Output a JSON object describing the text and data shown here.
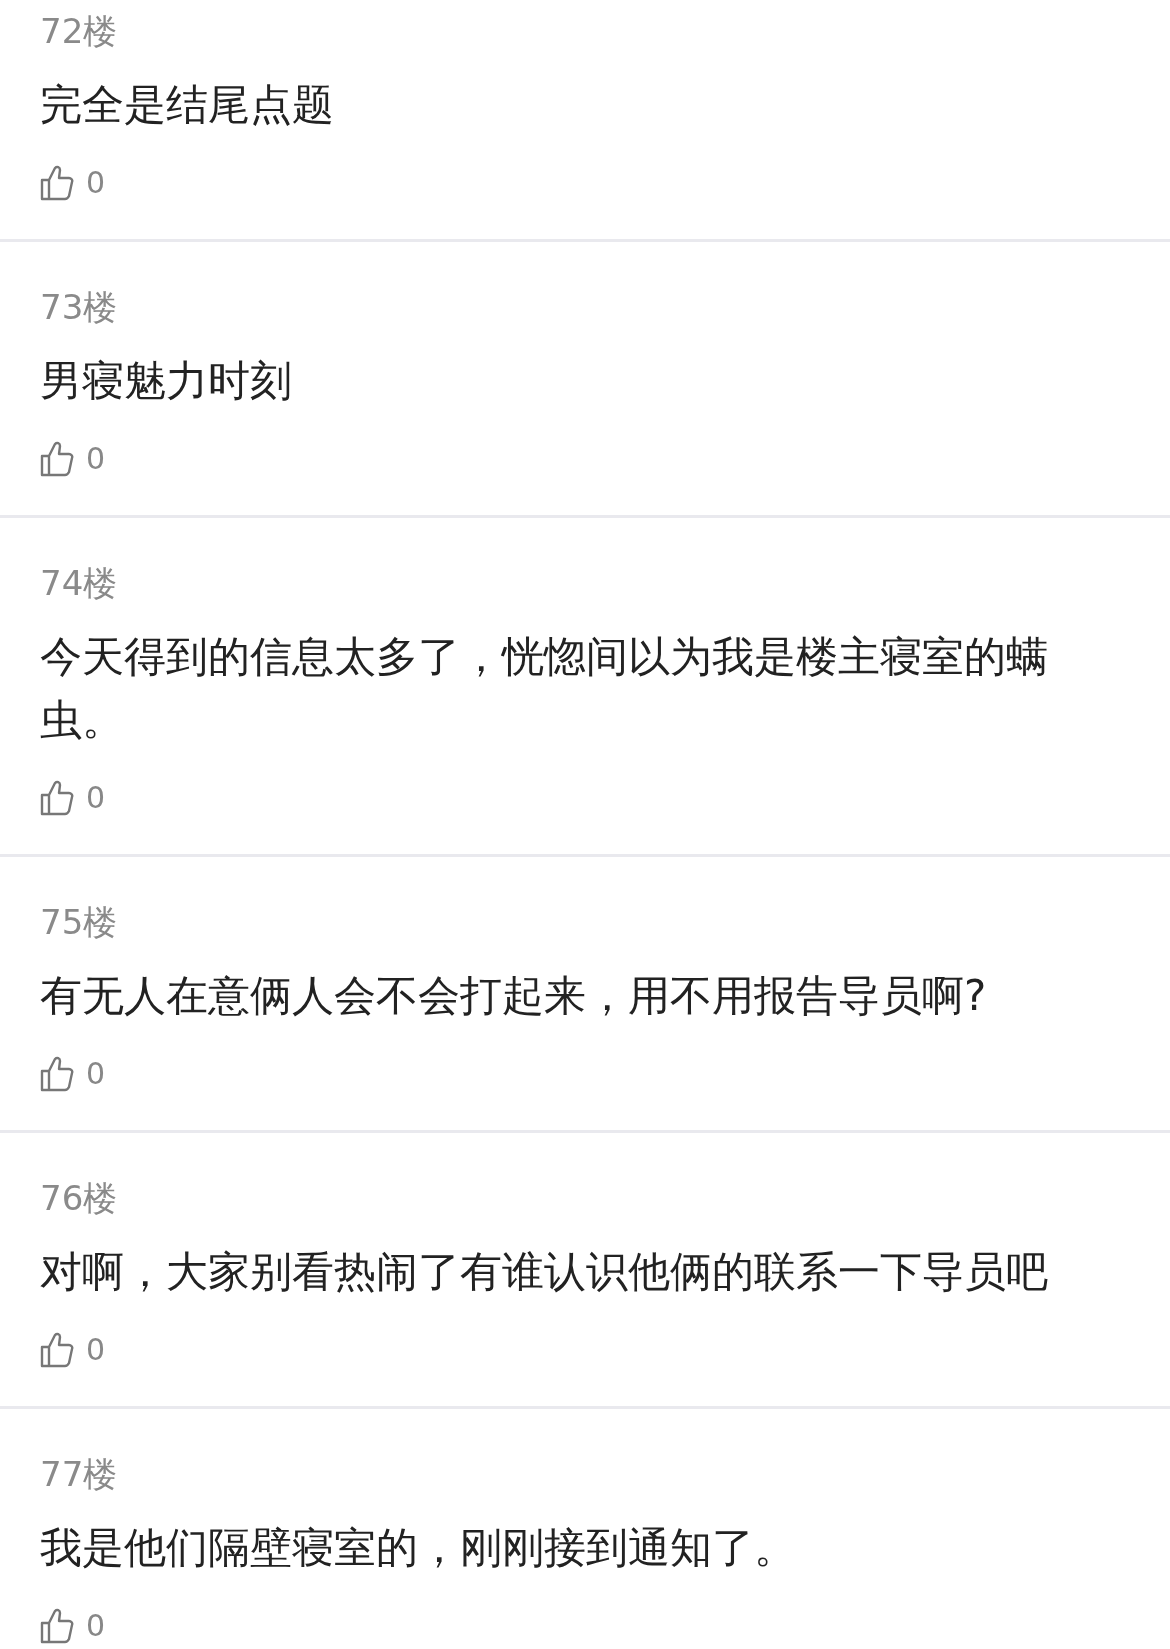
{
  "posts": [
    {
      "floor": "72楼",
      "content": "完全是结尾点题",
      "likes": "0"
    },
    {
      "floor": "73楼",
      "content": "男寝魅力时刻",
      "likes": "0"
    },
    {
      "floor": "74楼",
      "content": "今天得到的信息太多了，恍惚间以为我是楼主寝室的螨虫。",
      "likes": "0"
    },
    {
      "floor": "75楼",
      "content": "有无人在意俩人会不会打起来，用不用报告导员啊?",
      "likes": "0"
    },
    {
      "floor": "76楼",
      "content": "对啊，大家别看热闹了有谁认识他俩的联系一下导员吧",
      "likes": "0"
    },
    {
      "floor": "77楼",
      "content": "我是他们隔壁寝室的，刚刚接到通知了。",
      "likes": "0"
    }
  ]
}
